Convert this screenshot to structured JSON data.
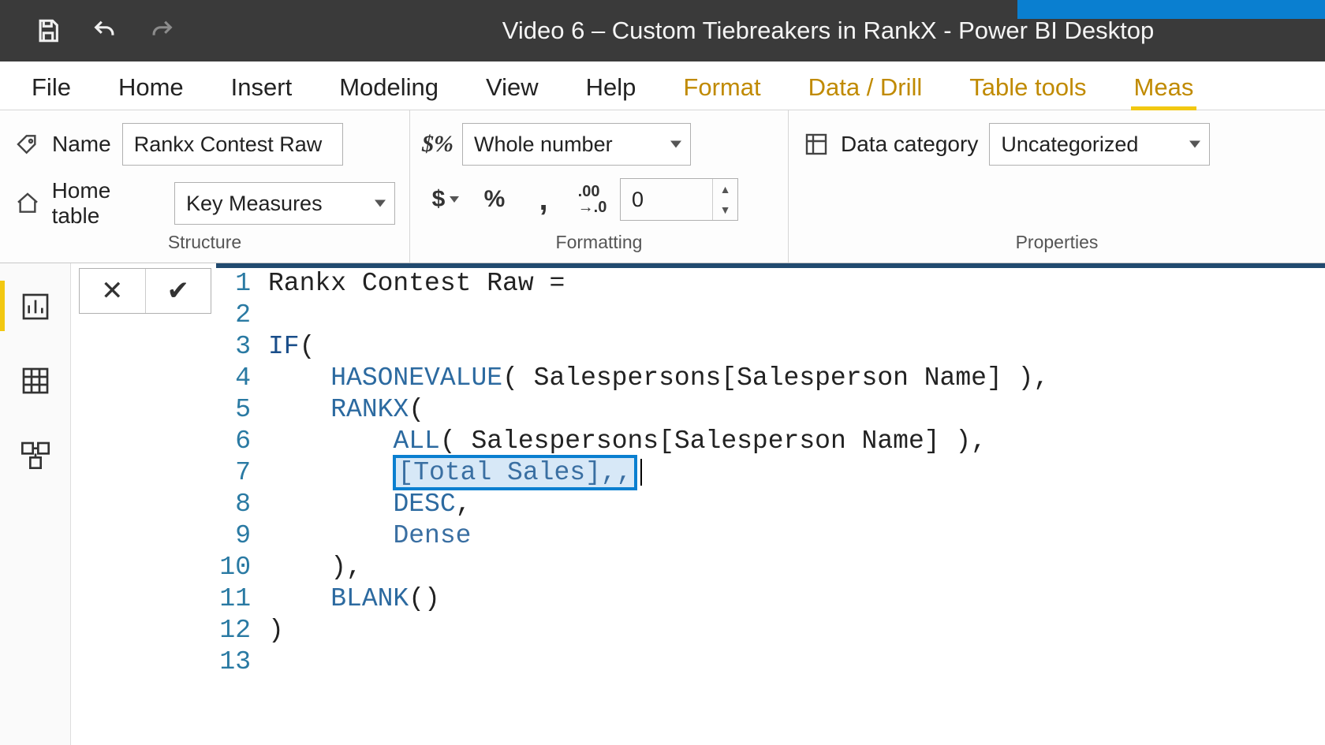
{
  "titlebar": {
    "doc_title": "Video 6 – Custom Tiebreakers in RankX - Power BI Desktop"
  },
  "ribbon_tabs": [
    "File",
    "Home",
    "Insert",
    "Modeling",
    "View",
    "Help",
    "Format",
    "Data / Drill",
    "Table tools",
    "Meas"
  ],
  "ribbon": {
    "structure": {
      "name_label": "Name",
      "name_value": "Rankx Contest Raw",
      "home_table_label": "Home table",
      "home_table_value": "Key Measures",
      "caption": "Structure"
    },
    "formatting": {
      "datatype_value": "Whole number",
      "decimal_value": "0",
      "caption": "Formatting"
    },
    "properties": {
      "data_category_label": "Data category",
      "data_category_value": "Uncategorized",
      "caption": "Properties"
    }
  },
  "editor": {
    "line_numbers": [
      "1",
      "2",
      "3",
      "4",
      "5",
      "6",
      "7",
      "8",
      "9",
      "10",
      "11",
      "12",
      "13"
    ],
    "lines": {
      "l1": "Rankx Contest Raw =",
      "l2": "",
      "l3_fn": "IF",
      "l3_rest": "(",
      "l4_fn": "HASONEVALUE",
      "l4_rest": "( Salespersons[Salesperson Name] ),",
      "l5_fn": "RANKX",
      "l5_rest": "(",
      "l6_fn": "ALL",
      "l6_rest": "( Salespersons[Salesperson Name] ),",
      "l7_sel": "[Total Sales],,",
      "l8_fn": "DESC",
      "l8_rest": ",",
      "l9_fn": "Dense",
      "l10": "    ),",
      "l11_fn": "BLANK",
      "l11_rest": "()",
      "l12": ")",
      "l13": ""
    }
  }
}
